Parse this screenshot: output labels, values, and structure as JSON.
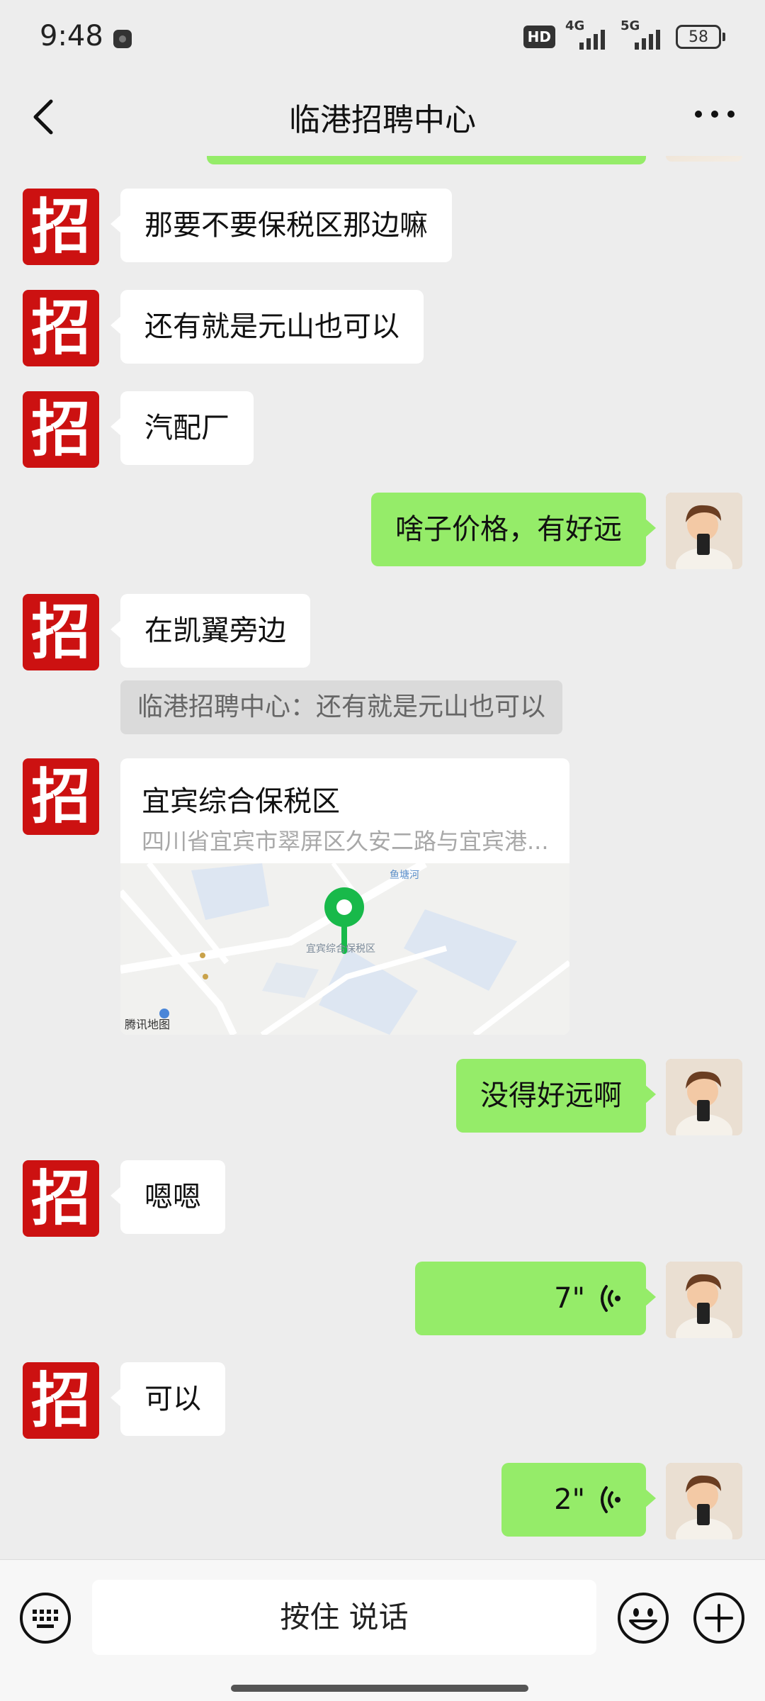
{
  "status": {
    "time": "9:48",
    "hd_label": "HD",
    "net1": "4G",
    "net2": "5G",
    "battery": "58"
  },
  "header": {
    "title": "临港招聘中心"
  },
  "chat": {
    "contact_avatar_text": "招",
    "messages": [
      {
        "side": "left",
        "text": "那要不要保税区那边嘛"
      },
      {
        "side": "left",
        "text": "还有就是元山也可以"
      },
      {
        "side": "left",
        "text": "汽配厂"
      },
      {
        "side": "right",
        "text": "啥子价格，有好远"
      },
      {
        "side": "left",
        "text": "在凯翼旁边"
      },
      {
        "quote": "临港招聘中心：还有就是元山也可以"
      },
      {
        "side": "left",
        "type": "location",
        "title": "宜宾综合保税区",
        "address": "四川省宜宾市翠屏区久安二路与宜宾港...",
        "map_place": "宜宾综合保税区",
        "map_river": "鱼塘河",
        "map_credit": "腾讯地图"
      },
      {
        "side": "right",
        "text": "没得好远啊"
      },
      {
        "side": "left",
        "text": "嗯嗯"
      },
      {
        "side": "right",
        "type": "voice",
        "duration": "7\""
      },
      {
        "side": "left",
        "text": "可以"
      },
      {
        "side": "right",
        "type": "voice",
        "duration": "2\""
      }
    ]
  },
  "input": {
    "hold_to_talk": "按住 说话"
  },
  "colors": {
    "background": "#ededed",
    "bubble_right": "#95ec69",
    "bubble_left": "#ffffff",
    "avatar_red": "#cc1111",
    "pin_green": "#18b94a"
  },
  "icons": [
    "back-icon",
    "more-icon",
    "keyboard-icon",
    "emoji-icon",
    "plus-icon",
    "voice-wave-icon",
    "location-pin-icon"
  ]
}
